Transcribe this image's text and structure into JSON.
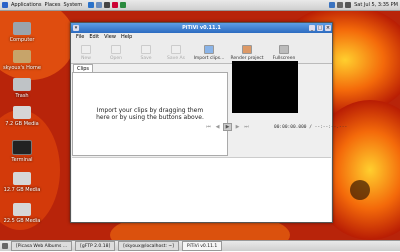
{
  "top_panel": {
    "menus": [
      "Applications",
      "Places",
      "System"
    ],
    "clock": "Sat Jul 5, 3:35 PM"
  },
  "desktop_icons": [
    {
      "label": "Computer"
    },
    {
      "label": "skyoux's Home"
    },
    {
      "label": "Trash"
    },
    {
      "label": "7.2 GB Media"
    },
    {
      "label": "Terminal"
    },
    {
      "label": "12.7 GB Media"
    },
    {
      "label": "22.5 GB Media"
    }
  ],
  "window": {
    "title": "PiTiVi v0.11.1",
    "menu": [
      "File",
      "Edit",
      "View",
      "Help"
    ],
    "toolbar": [
      {
        "label": "New",
        "enabled": false
      },
      {
        "label": "Open",
        "enabled": false
      },
      {
        "label": "Save",
        "enabled": false
      },
      {
        "label": "Save As",
        "enabled": false
      },
      {
        "label": "Import clips...",
        "enabled": true
      },
      {
        "label": "Render project",
        "enabled": true
      },
      {
        "label": "Fullscreen",
        "enabled": true
      }
    ],
    "clips_tab": "Clips",
    "clips_message": "Import your clips by dragging them here or by using the buttons above.",
    "timecode": "00:00:00.000 / --:--:--.---"
  },
  "taskbar": [
    {
      "label": "[Picasa Web Albums ...",
      "active": false
    },
    {
      "label": "[gFTP 2.0.18]",
      "active": false
    },
    {
      "label": "[skyoux@localhost: ~]",
      "active": false
    },
    {
      "label": "PiTiVi v0.11.1",
      "active": true
    }
  ],
  "colors": {
    "wallpaper": "#c92d06",
    "titlebar": "#3b7fd4",
    "viewer": "#000000"
  }
}
